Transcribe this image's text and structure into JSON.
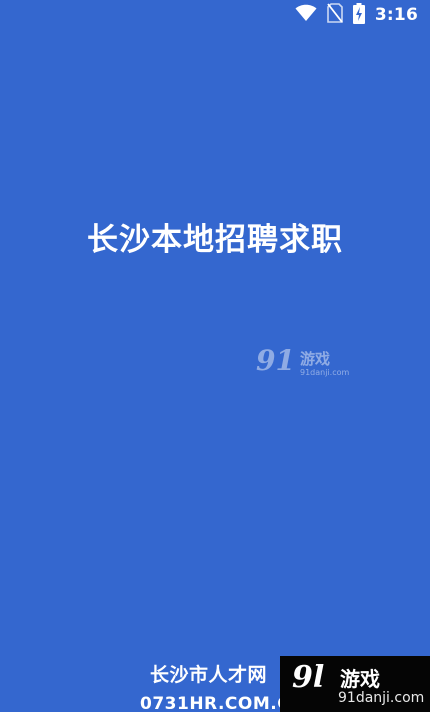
{
  "status_bar": {
    "time": "3:16",
    "icons": [
      "wifi-icon",
      "no-sim-icon",
      "battery-charging-icon"
    ]
  },
  "splash": {
    "title": "长沙本地招聘求职",
    "footer_name": "长沙市人才网",
    "footer_site": "0731HR.COM.CN"
  },
  "watermark_center": {
    "logo": "91",
    "text": "游戏",
    "url": "91danji.com"
  },
  "watermark_corner": {
    "logo": "9l",
    "text": "游戏",
    "url": "91danji.com"
  },
  "colors": {
    "background": "#3467cf",
    "text": "#ffffff",
    "watermark_bg": "#050505"
  }
}
